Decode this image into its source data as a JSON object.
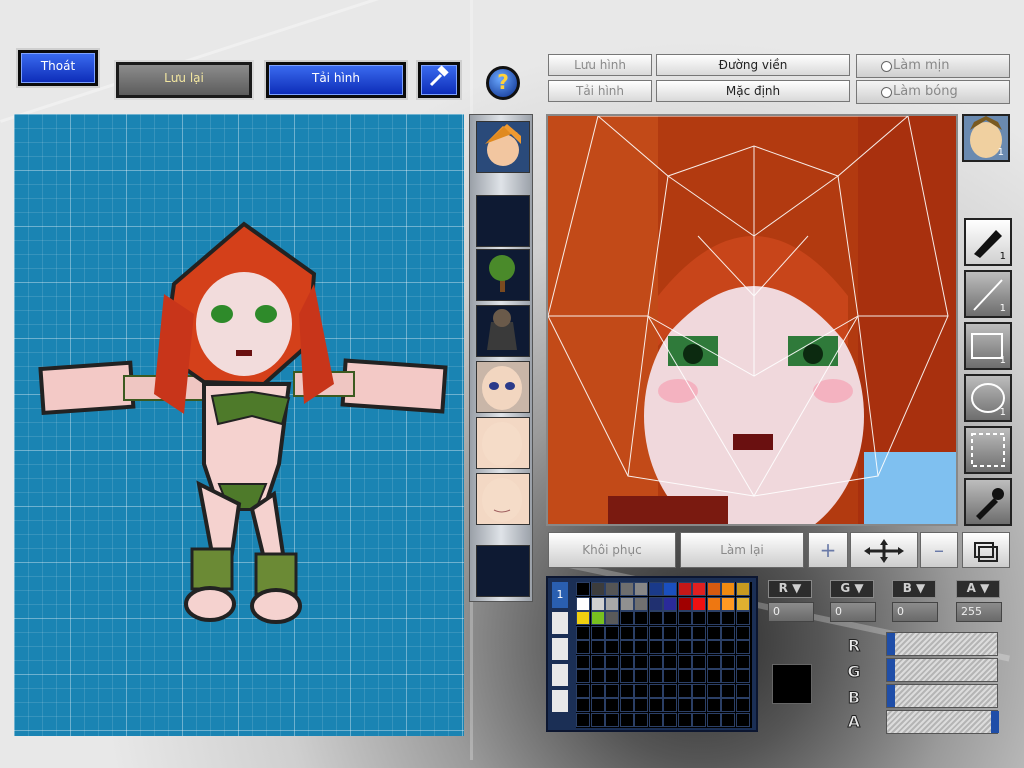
{
  "toolbar": {
    "exit_label": "Thoát",
    "save_label": "Lưu lại",
    "reload_label": "Tải hình",
    "help_glyph": "?"
  },
  "editor_options": {
    "save_image": "Lưu hình",
    "load_image": "Tải hình",
    "outline": "Đường viền",
    "default": "Mặc định",
    "smooth": "Làm mịn",
    "shade": "Làm bóng"
  },
  "parts": [
    {
      "name": "head"
    },
    {
      "name": "empty"
    },
    {
      "name": "tree"
    },
    {
      "name": "body"
    },
    {
      "name": "face"
    },
    {
      "name": "skin-1"
    },
    {
      "name": "skin-2"
    },
    {
      "name": "empty"
    }
  ],
  "tools": {
    "character_count": "1",
    "pen_count": "1",
    "line_count": "1",
    "rect_count": "1",
    "ellipse_count": "1"
  },
  "bottom_actions": {
    "restore": "Khôi phục",
    "redo": "Làm lại"
  },
  "palette": {
    "tab_label": "1",
    "colors_row1": [
      "#000000",
      "#3c3c3c",
      "#555555",
      "#6e6e6e",
      "#878787",
      "#1a3a8a",
      "#1a4fbf",
      "#c41818",
      "#e02020",
      "#d65a10",
      "#f08a10",
      "#c89a20"
    ],
    "colors_row2": [
      "#ffffff",
      "#d0d0d0",
      "#a8a8a8",
      "#909090",
      "#707070",
      "#203070",
      "#2a2a9a",
      "#a00000",
      "#ee1111",
      "#ee7711",
      "#ff9922",
      "#e0b030"
    ],
    "colors_row3": [
      "#f0d010",
      "#78c020",
      "#5a5a5a"
    ],
    "current_color": "#000000"
  },
  "channels": {
    "r_label": "R",
    "g_label": "G",
    "b_label": "B",
    "a_label": "A",
    "r_value": "0",
    "g_value": "0",
    "b_value": "0",
    "a_value": "255"
  }
}
